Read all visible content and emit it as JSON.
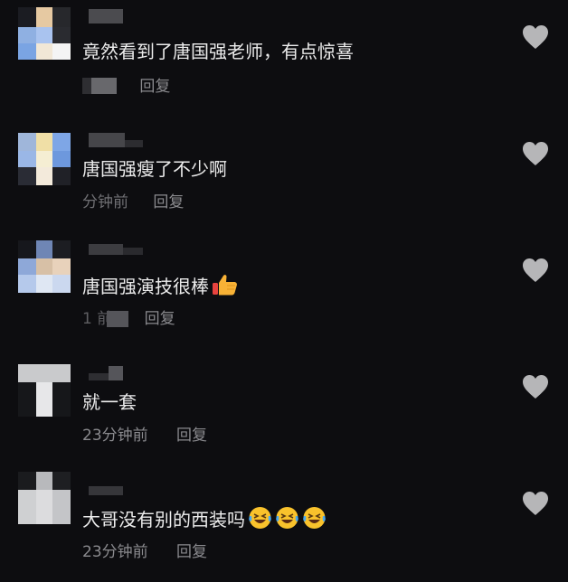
{
  "reply_label": "回复",
  "icons": {
    "like": "heart-icon"
  },
  "colors": {
    "background": "#0d0d10",
    "text": "#ececec",
    "meta": "#8a8a8e",
    "heart": "#b6b6b8"
  },
  "comments": [
    {
      "text": "竟然看到了唐国强老师，有点惊喜",
      "time": "",
      "emoji": []
    },
    {
      "text": "唐国强瘦了不少啊",
      "time": "分钟前",
      "emoji": []
    },
    {
      "text": "唐国强演技很棒",
      "time": "1 前",
      "emoji": [
        "thumbs-up-emoji"
      ]
    },
    {
      "text": "就一套",
      "time": "23分钟前",
      "emoji": []
    },
    {
      "text": "大哥没有别的西装吗",
      "time": "23分钟前",
      "emoji": [
        "laughing-emoji",
        "laughing-emoji",
        "laughing-emoji"
      ]
    }
  ]
}
